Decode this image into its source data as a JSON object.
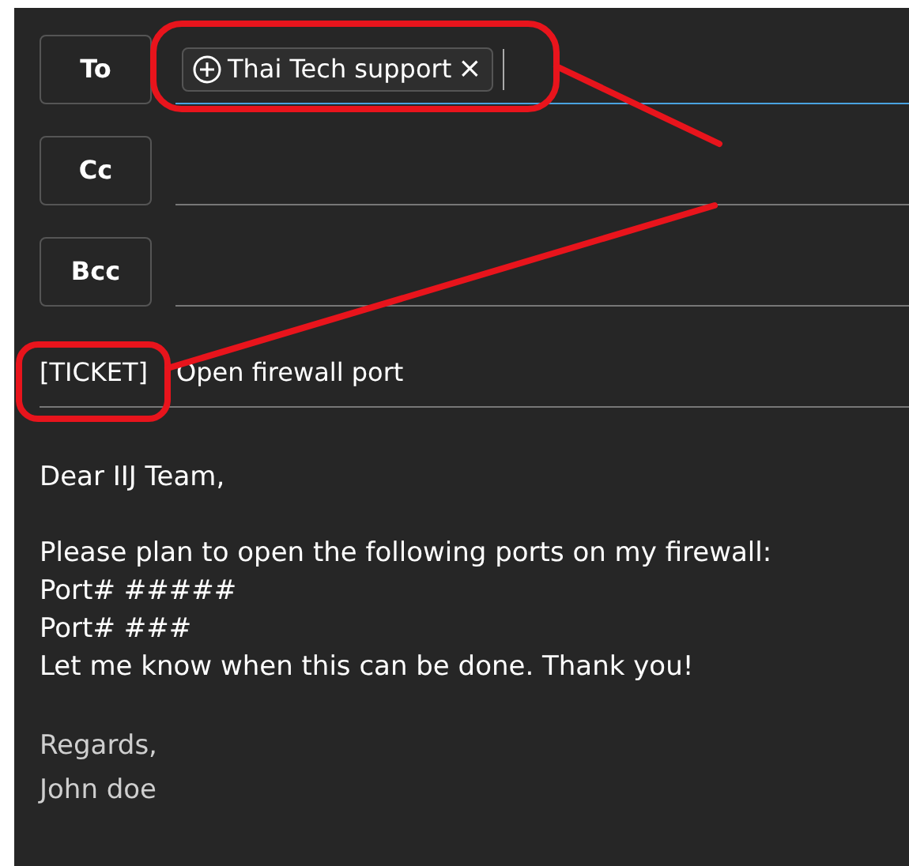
{
  "header_fields": [
    {
      "label": "To",
      "focused": true,
      "recipients": [
        {
          "name": "Thai Tech support",
          "remove": "×"
        }
      ]
    },
    {
      "label": "Cc",
      "focused": false
    },
    {
      "label": "Bcc",
      "focused": false
    }
  ],
  "subject": {
    "tag": "[TICKET]",
    "text": "Open firewall port"
  },
  "body": [
    {
      "kind": "text",
      "lines": [
        "Dear IIJ Team,"
      ]
    },
    {
      "kind": "text",
      "lines": [
        "Please plan to open the following ports on my firewall:",
        "Port# #####",
        "Port# ###",
        "Let me know when this can be done. Thank you!"
      ]
    },
    {
      "kind": "signature",
      "lines": [
        "Regards,",
        "John doe"
      ]
    }
  ]
}
